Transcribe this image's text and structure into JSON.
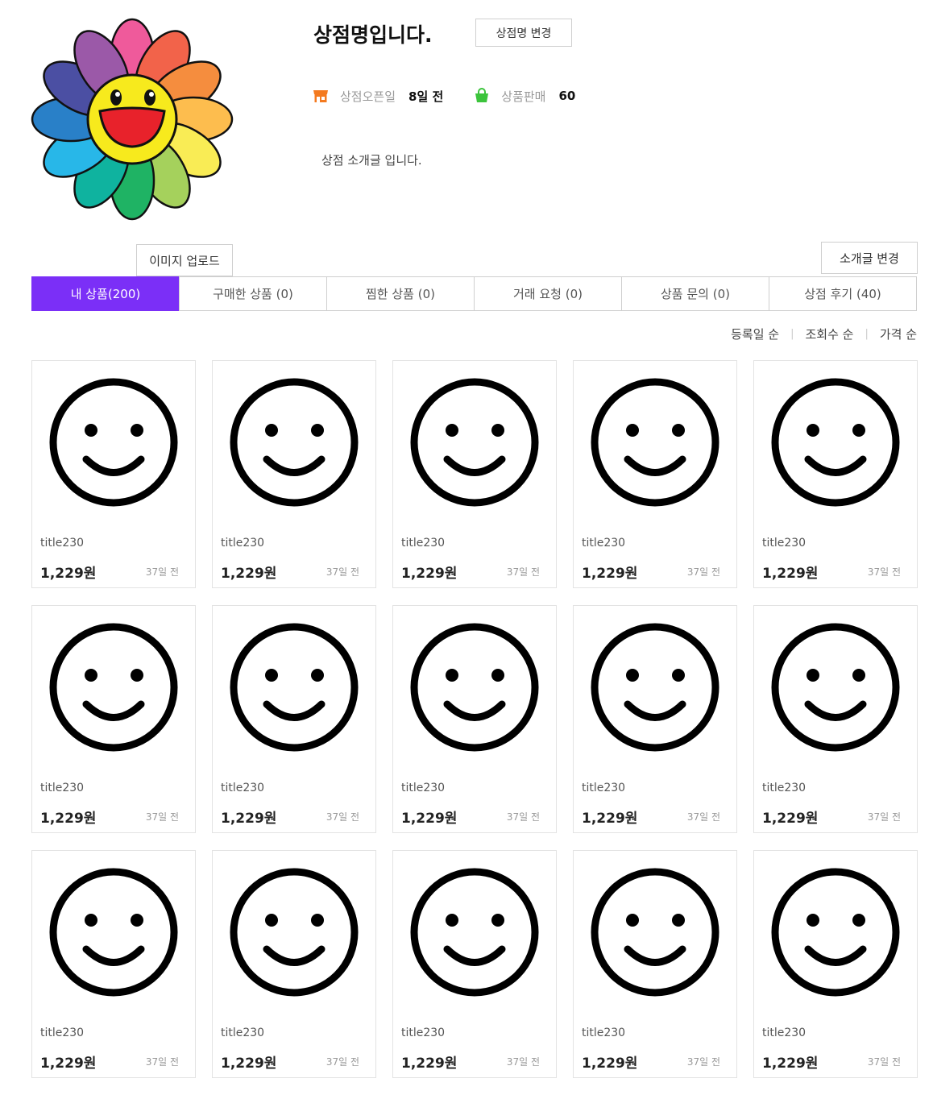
{
  "shop": {
    "name": "상점명입니다.",
    "rename_label": "상점명 변경",
    "open_label": "상점오픈일",
    "open_value": "8일 전",
    "sales_label": "상품판매",
    "sales_value": "60",
    "intro": "상점 소개글 입니다.",
    "intro_edit_label": "소개글 변경",
    "upload_label": "이미지 업로드",
    "avatar_icon": "flower-avatar",
    "store_icon": "store-icon",
    "store_icon_color": "#f47a1f",
    "bag_icon": "shopping-bag-icon",
    "bag_icon_color": "#3cc43c"
  },
  "tabs": [
    {
      "label": "내 상품(200)"
    },
    {
      "label": "구매한 상품 (0)"
    },
    {
      "label": "찜한 상품 (0)"
    },
    {
      "label": "거래 요청 (0)"
    },
    {
      "label": "상품 문의 (0)"
    },
    {
      "label": "상점 후기 (40)"
    }
  ],
  "accent_color": "#7b2ff7",
  "sort": {
    "options": [
      "등록일 순",
      "조회수 순",
      "가격 순"
    ],
    "separator": "|"
  },
  "products": [
    {
      "title": "title230",
      "price": "1,229원",
      "date": "37일 전",
      "icon": "smiley-icon"
    },
    {
      "title": "title230",
      "price": "1,229원",
      "date": "37일 전",
      "icon": "smiley-icon"
    },
    {
      "title": "title230",
      "price": "1,229원",
      "date": "37일 전",
      "icon": "smiley-icon"
    },
    {
      "title": "title230",
      "price": "1,229원",
      "date": "37일 전",
      "icon": "smiley-icon"
    },
    {
      "title": "title230",
      "price": "1,229원",
      "date": "37일 전",
      "icon": "smiley-icon"
    },
    {
      "title": "title230",
      "price": "1,229원",
      "date": "37일 전",
      "icon": "smiley-icon"
    },
    {
      "title": "title230",
      "price": "1,229원",
      "date": "37일 전",
      "icon": "smiley-icon"
    },
    {
      "title": "title230",
      "price": "1,229원",
      "date": "37일 전",
      "icon": "smiley-icon"
    },
    {
      "title": "title230",
      "price": "1,229원",
      "date": "37일 전",
      "icon": "smiley-icon"
    },
    {
      "title": "title230",
      "price": "1,229원",
      "date": "37일 전",
      "icon": "smiley-icon"
    },
    {
      "title": "title230",
      "price": "1,229원",
      "date": "37일 전",
      "icon": "smiley-icon"
    },
    {
      "title": "title230",
      "price": "1,229원",
      "date": "37일 전",
      "icon": "smiley-icon"
    },
    {
      "title": "title230",
      "price": "1,229원",
      "date": "37일 전",
      "icon": "smiley-icon"
    },
    {
      "title": "title230",
      "price": "1,229원",
      "date": "37일 전",
      "icon": "smiley-icon"
    },
    {
      "title": "title230",
      "price": "1,229원",
      "date": "37일 전",
      "icon": "smiley-icon"
    }
  ]
}
